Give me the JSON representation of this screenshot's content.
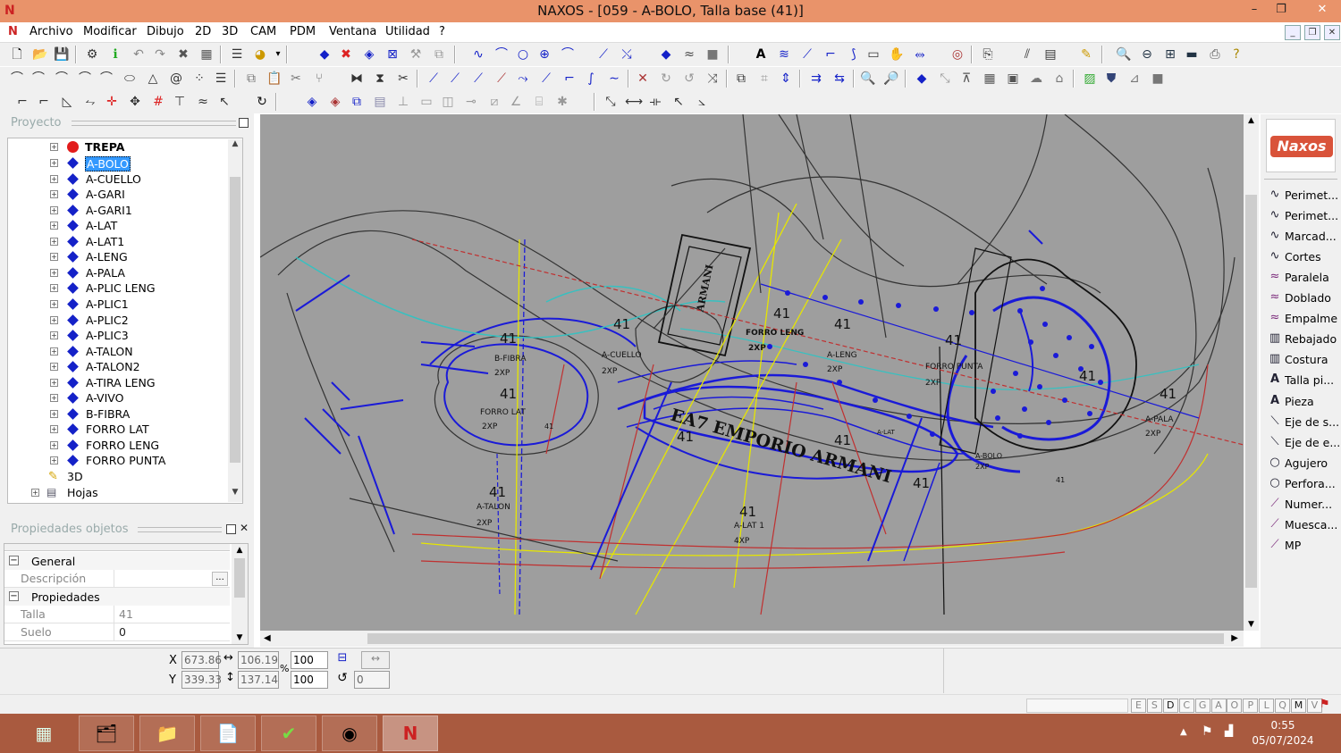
{
  "window": {
    "title": "NAXOS - [059 - A-BOLO, Talla base (41)]",
    "app_icon": "N",
    "minimize": "–",
    "restore": "❐",
    "close": "✕"
  },
  "menu": [
    "Archivo",
    "Modificar",
    "Dibujo",
    "2D",
    "3D",
    "CAM",
    "PDM",
    "Ventana",
    "Utilidad",
    "?"
  ],
  "project_panel": {
    "title": "Proyecto",
    "root": "TREPA",
    "items": [
      "A-BOLO",
      "A-CUELLO",
      "A-GARI",
      "A-GARI1",
      "A-LAT",
      "A-LAT1",
      "A-LENG",
      "A-PALA",
      "A-PLIC LENG",
      "A-PLIC1",
      "A-PLIC2",
      "A-PLIC3",
      "A-TALON",
      "A-TALON2",
      "A-TIRA LENG",
      "A-VIVO",
      "B-FIBRA",
      "FORRO LAT",
      "FORRO LENG",
      "FORRO PUNTA"
    ],
    "selected": "A-BOLO",
    "extra": [
      "3D",
      "Hojas"
    ]
  },
  "properties_panel": {
    "title": "Propiedades objetos",
    "sections": [
      {
        "name": "General",
        "rows": [
          {
            "key": "Descripción",
            "value": ""
          }
        ]
      },
      {
        "name": "Propiedades",
        "rows": [
          {
            "key": "Talla",
            "value": "41"
          },
          {
            "key": "Suelo",
            "value": "0"
          }
        ]
      }
    ],
    "more_button": "..."
  },
  "right_panel": {
    "logo": "Naxos",
    "items": [
      {
        "icon": "curve-icon",
        "label": "Perimet..."
      },
      {
        "icon": "curve-icon",
        "label": "Perimet..."
      },
      {
        "icon": "curve-icon",
        "label": "Marcad..."
      },
      {
        "icon": "curve-icon",
        "label": "Cortes"
      },
      {
        "icon": "parallel-icon",
        "label": "Paralela"
      },
      {
        "icon": "parallel-icon",
        "label": "Doblado"
      },
      {
        "icon": "parallel-icon",
        "label": "Empalme"
      },
      {
        "icon": "stitch-icon",
        "label": "Rebajado"
      },
      {
        "icon": "stitch-icon",
        "label": "Costura"
      },
      {
        "icon": "text-icon",
        "label": "Talla pi..."
      },
      {
        "icon": "text-icon",
        "label": "Pieza"
      },
      {
        "icon": "axis-icon",
        "label": "Eje de s..."
      },
      {
        "icon": "axis-icon",
        "label": "Eje de e..."
      },
      {
        "icon": "circle-icon",
        "label": "Agujero"
      },
      {
        "icon": "circle-icon",
        "label": "Perfora..."
      },
      {
        "icon": "pen-icon",
        "label": "Numer..."
      },
      {
        "icon": "pen-icon",
        "label": "Muesca..."
      },
      {
        "icon": "pen-icon",
        "label": "MP"
      }
    ]
  },
  "canvas": {
    "pieces": [
      {
        "num": "41",
        "name": "B-FIBRA",
        "qty": "2XP"
      },
      {
        "num": "41",
        "name": "A-CUELLO",
        "qty": "2XP"
      },
      {
        "num": "41",
        "name": "FORRO LENG",
        "qty": "2XP"
      },
      {
        "num": "41",
        "name": "A-LENG",
        "qty": "2XP"
      },
      {
        "num": "41",
        "name": "FORRO PUNTA",
        "qty": "2XP"
      },
      {
        "num": "41",
        "name": "A-PALA",
        "qty": "2XP"
      },
      {
        "num": "41",
        "name": "A-TALON",
        "qty": "2XP"
      },
      {
        "num": "41",
        "name": "A-LAT 1",
        "qty": "4XP"
      },
      {
        "num": "41",
        "name": "A-BOLO",
        "qty": "2XP"
      },
      {
        "num": "41",
        "name": "FORRO LAT",
        "qty": "2XP"
      }
    ],
    "brand": "EA7 EMPORIO ARMANI",
    "brand_short": "ARMANI",
    "extra_labels": [
      "41",
      "41",
      "41",
      "A-LAT",
      "41",
      "41"
    ]
  },
  "coords": {
    "x_label": "X",
    "y_label": "Y",
    "x": "673.86",
    "y": "339.33",
    "w": "106.19",
    "h": "137.14",
    "pct_label": "%",
    "scale_x": "100",
    "scale_y": "100",
    "angle": "0",
    "w_icon": "↔",
    "h_icon": "↕",
    "rotate_icon": "↺"
  },
  "status_keys": [
    "E",
    "S",
    "D",
    "C",
    "G",
    "A",
    "O",
    "P",
    "L",
    "Q",
    "M",
    "V"
  ],
  "taskbar": {
    "time": "0:55",
    "date": "05/07/2024"
  },
  "colors": {
    "titlebar": "#e9936a",
    "canvas": "#9e9e9e",
    "selection": "#3399ff",
    "taskbar": "#a95a3f",
    "piece_blue": "#1a1ad8"
  }
}
